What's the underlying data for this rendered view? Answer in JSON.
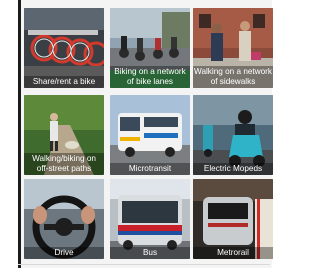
{
  "tiles": [
    {
      "label": "Share/rent a bike",
      "image": "bike-share-dock"
    },
    {
      "label": "Biking on a network\nof bike lanes",
      "image": "cyclists-in-bike-lane"
    },
    {
      "label": "Walking on a network\nof sidewalks",
      "image": "people-on-sidewalk"
    },
    {
      "label": "Walking/biking on\noff-street paths",
      "image": "person-walking-dog-on-trail"
    },
    {
      "label": "Microtransit",
      "image": "microtransit-van"
    },
    {
      "label": "Electric Mopeds",
      "image": "person-on-electric-moped"
    },
    {
      "label": "Drive",
      "image": "hands-on-steering-wheel"
    },
    {
      "label": "Bus",
      "image": "city-bus"
    },
    {
      "label": "Metrorail",
      "image": "metro-train-at-station"
    }
  ]
}
